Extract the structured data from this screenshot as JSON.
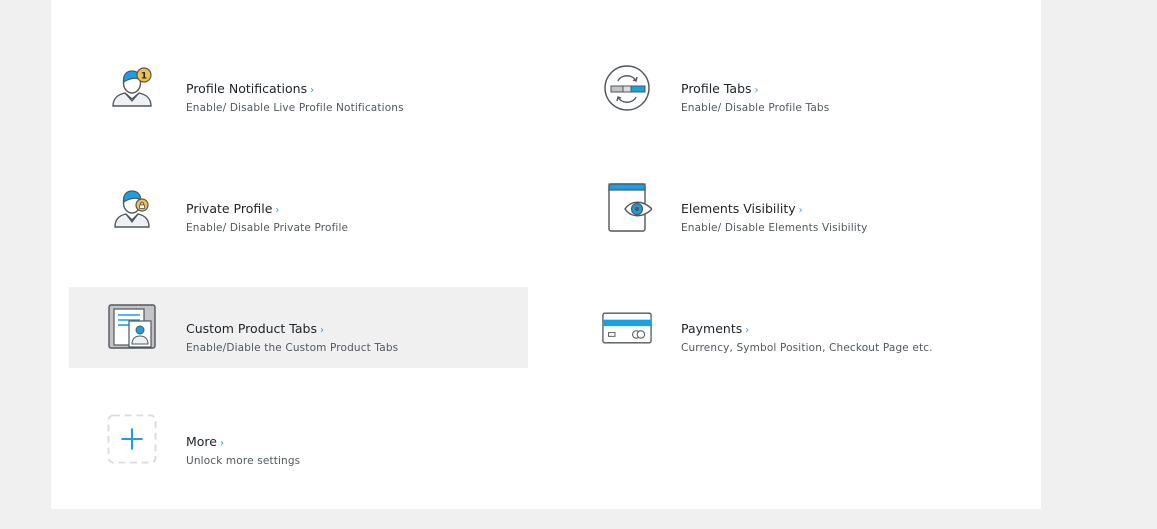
{
  "colors": {
    "accent": "#1a9ee4",
    "active_bg": "#f0f0f1",
    "panel_bg": "#ffffff",
    "page_bg": "#f0f0f1"
  },
  "items": [
    {
      "title": "Profile Notifications",
      "arrow": "›",
      "description": "Enable/ Disable Live Profile Notifications",
      "icon": "user-notification-icon"
    },
    {
      "title": "Profile Tabs",
      "arrow": "›",
      "description": "Enable/ Disable Profile Tabs",
      "icon": "toggle-sync-icon"
    },
    {
      "title": "Private Profile",
      "arrow": "›",
      "description": "Enable/ Disable Private Profile",
      "icon": "user-lock-icon"
    },
    {
      "title": "Elements Visibility",
      "arrow": "›",
      "description": "Enable/ Disable Elements Visibility",
      "icon": "window-eye-icon"
    },
    {
      "title": "Custom Product Tabs",
      "arrow": "›",
      "description": "Enable/Diable the Custom Product Tabs",
      "icon": "product-card-icon",
      "active": true
    },
    {
      "title": "Payments",
      "arrow": "›",
      "description": "Currency, Symbol Position, Checkout Page etc.",
      "icon": "credit-card-icon"
    },
    {
      "title": "More",
      "arrow": "›",
      "description": "Unlock more settings",
      "icon": "add-more-icon"
    }
  ]
}
